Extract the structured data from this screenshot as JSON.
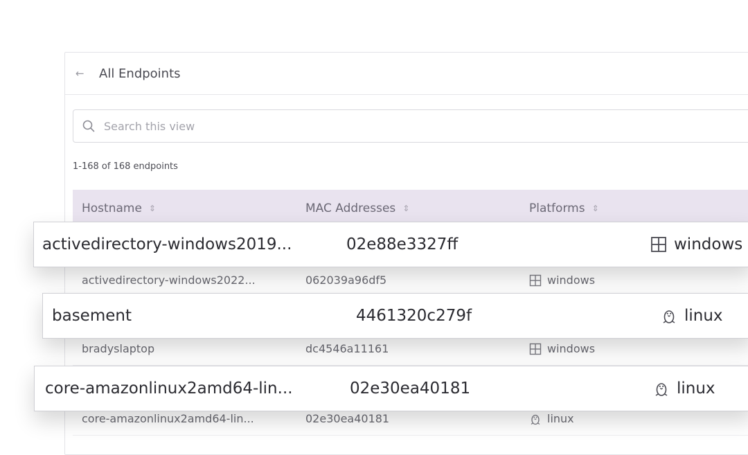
{
  "header": {
    "back_label": "All Endpoints"
  },
  "search": {
    "placeholder": "Search this view"
  },
  "summary": {
    "count_text": "1-168 of 168 endpoints"
  },
  "table": {
    "columns": [
      {
        "label": "Hostname"
      },
      {
        "label": "MAC Addresses"
      },
      {
        "label": "Platforms"
      }
    ],
    "rows": [
      {
        "hostname": "activedirectory-windows2022...",
        "mac": "062039a96df5",
        "platform": "windows",
        "platform_icon": "windows-icon"
      },
      {
        "hostname": "bradyslaptop",
        "mac": "dc4546a11161",
        "platform": "windows",
        "platform_icon": "windows-icon"
      },
      {
        "hostname": "core-amazonlinux2amd64-lin...",
        "mac": "02e30ea40181",
        "platform": "linux",
        "platform_icon": "linux-icon"
      }
    ]
  },
  "overlays": [
    {
      "hostname": "activedirectory-windows2019...",
      "mac": "02e88e3327ff",
      "platform": "windows",
      "platform_icon": "windows-icon"
    },
    {
      "hostname": "basement",
      "mac": "4461320c279f",
      "platform": "linux",
      "platform_icon": "linux-icon"
    },
    {
      "hostname": "core-amazonlinux2amd64-lin...",
      "mac": "02e30ea40181",
      "platform": "linux",
      "platform_icon": "linux-icon"
    }
  ],
  "colors": {
    "header_bg": "#e9e3ef",
    "text_primary": "#2a2a30",
    "text_muted": "#6a6a72"
  }
}
